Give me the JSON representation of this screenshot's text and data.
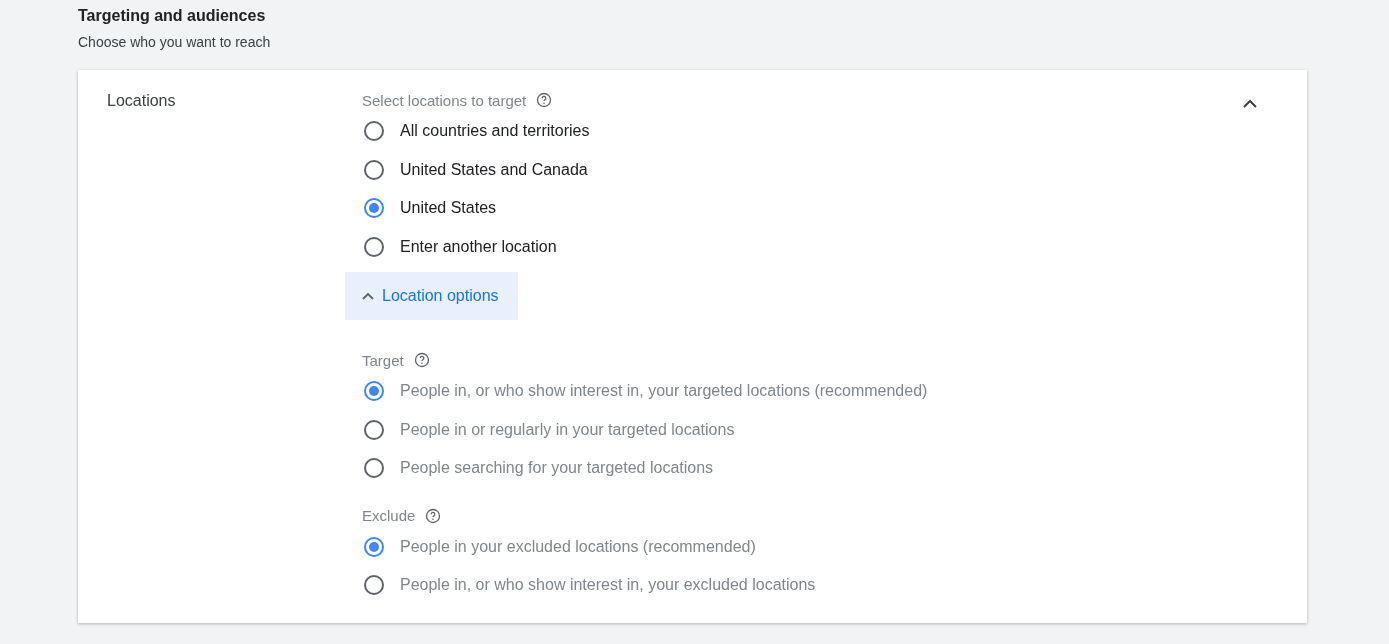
{
  "section": {
    "title": "Targeting and audiences",
    "subtitle": "Choose who you want to reach"
  },
  "card": {
    "label": "Locations",
    "expanded": true,
    "locations": {
      "label": "Select locations to target",
      "options": [
        {
          "label": "All countries and territories",
          "selected": false
        },
        {
          "label": "United States and Canada",
          "selected": false
        },
        {
          "label": "United States",
          "selected": true
        },
        {
          "label": "Enter another location",
          "selected": false
        }
      ]
    },
    "location_options": {
      "label": "Location options",
      "expanded": true,
      "groups": [
        {
          "label": "Target",
          "options": [
            {
              "label": "People in, or who show interest in, your targeted locations (recommended)",
              "selected": true
            },
            {
              "label": "People in or regularly in your targeted locations",
              "selected": false
            },
            {
              "label": "People searching for your targeted locations",
              "selected": false
            }
          ]
        },
        {
          "label": "Exclude",
          "options": [
            {
              "label": "People in your excluded locations (recommended)",
              "selected": true
            },
            {
              "label": "People in, or who show interest in, your excluded locations",
              "selected": false
            }
          ]
        }
      ]
    }
  }
}
